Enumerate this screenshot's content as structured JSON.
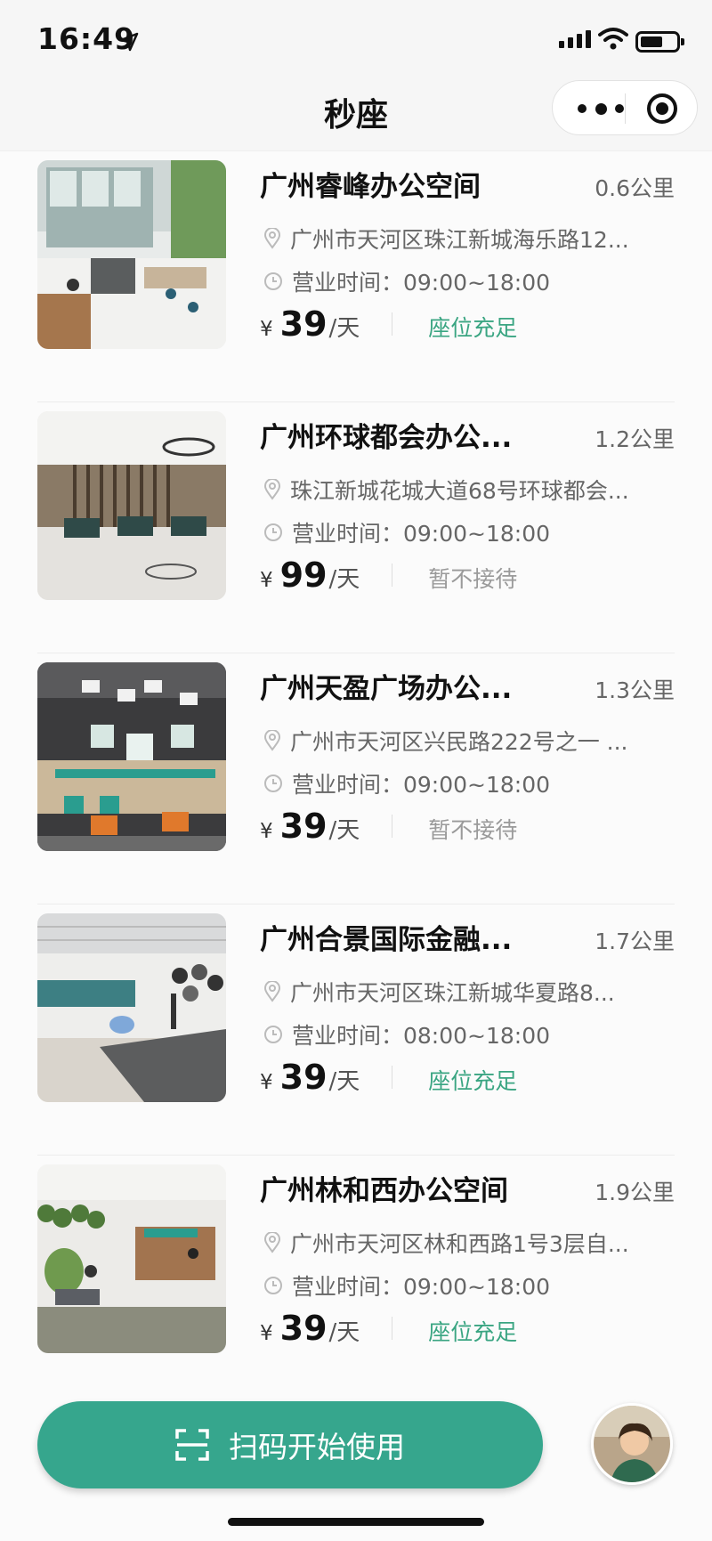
{
  "status_bar": {
    "time": "16:49"
  },
  "nav": {
    "title": "秒座"
  },
  "listings": [
    {
      "name": "广州睿峰办公空间",
      "distance": "0.6公里",
      "address": "广州市天河区珠江新城海乐路12...",
      "hours": "营业时间：09:00~18:00",
      "price": "39",
      "unit": "/天",
      "status": "座位充足",
      "available": true
    },
    {
      "name": "广州环球都会办公...",
      "distance": "1.2公里",
      "address": "珠江新城花城大道68号环球都会...",
      "hours": "营业时间：09:00~18:00",
      "price": "99",
      "unit": "/天",
      "status": "暂不接待",
      "available": false
    },
    {
      "name": "广州天盈广场办公...",
      "distance": "1.3公里",
      "address": "广州市天河区兴民路222号之一 ...",
      "hours": "营业时间：09:00~18:00",
      "price": "39",
      "unit": "/天",
      "status": "暂不接待",
      "available": false
    },
    {
      "name": "广州合景国际金融...",
      "distance": "1.7公里",
      "address": "广州市天河区珠江新城华夏路8...",
      "hours": "营业时间：08:00~18:00",
      "price": "39",
      "unit": "/天",
      "status": "座位充足",
      "available": true
    },
    {
      "name": "广州林和西办公空间",
      "distance": "1.9公里",
      "address": "广州市天河区林和西路1号3层自...",
      "hours": "营业时间：09:00~18:00",
      "price": "39",
      "unit": "/天",
      "status": "座位充足",
      "available": true
    }
  ],
  "currency_symbol": "¥",
  "colors": {
    "accent": "#36a68d",
    "status_available": "#3aa582",
    "status_unavailable": "#9a9a9a"
  },
  "icons": {
    "address": "location-pin-icon",
    "hours": "clock-icon",
    "scan": "scan-icon"
  },
  "bottom": {
    "scan_label": "扫码开始使用"
  }
}
